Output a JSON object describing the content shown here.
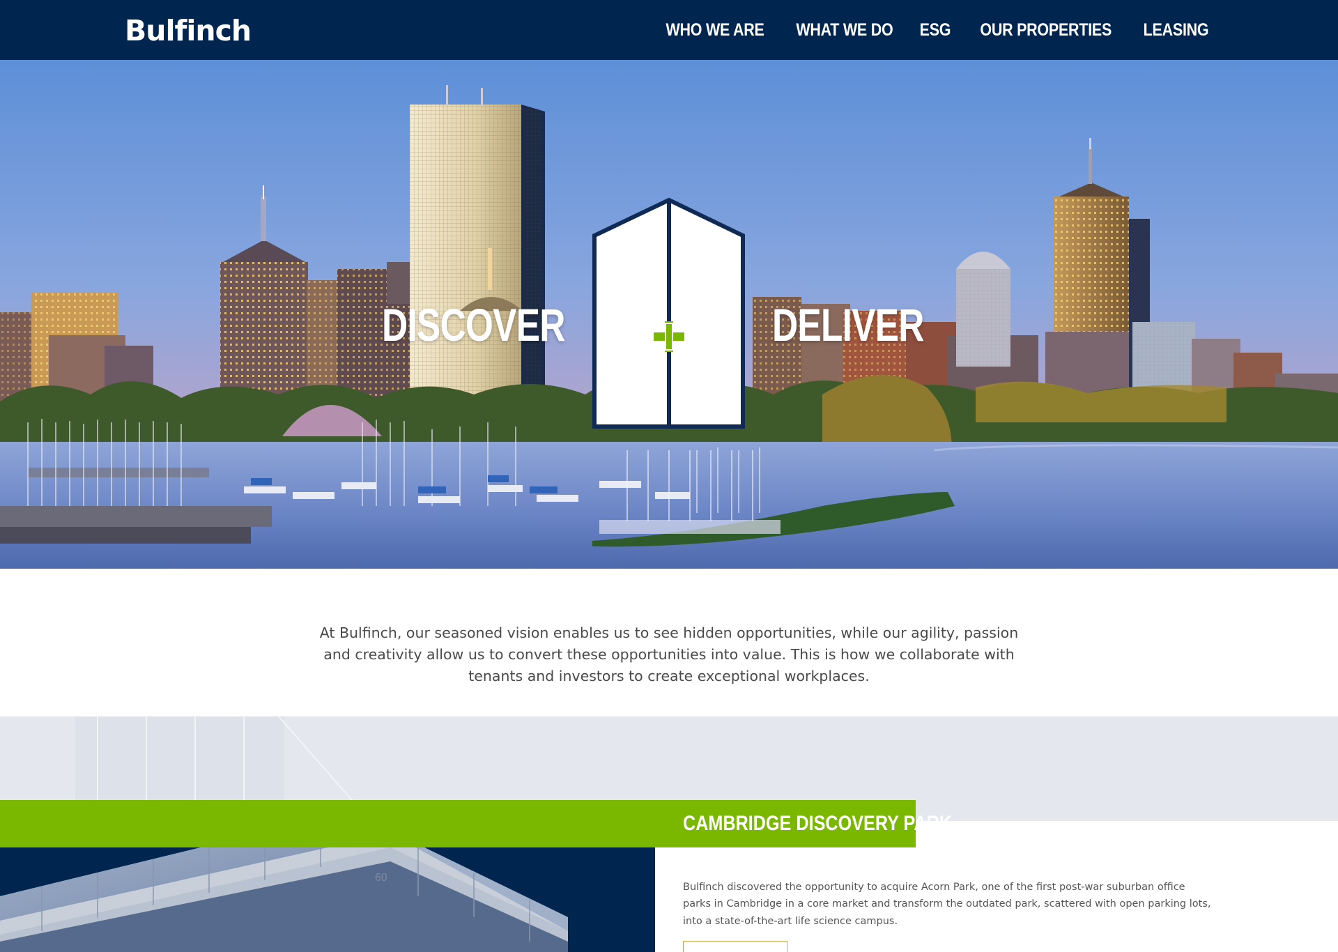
{
  "header": {
    "logo": "Bulfinch",
    "nav": [
      "WHO WE ARE",
      "WHAT WE DO",
      "ESG",
      "OUR PROPERTIES",
      "LEASING"
    ]
  },
  "hero": {
    "left_word": "DISCOVER",
    "right_word": "DELIVER",
    "plus": "+"
  },
  "intro": {
    "text": "At Bulfinch, our seasoned vision enables us to see hidden opportunities, while our agility, passion and creativity allow us to convert these opportunities into value. This is how we collaborate with tenants and investors to create exceptional workplaces."
  },
  "feature": {
    "title": "CAMBRIDGE DISCOVERY PARK",
    "text": "Bulfinch discovered the opportunity to acquire Acorn Park, one of the first post-war suburban office parks in Cambridge in a core market and transform the outdated park, scattered with open parking lots, into a state-of-the-art life science campus.",
    "building_number": "60"
  },
  "colors": {
    "navy": "#002650",
    "green": "#7ab800",
    "gold": "#c9a24a"
  }
}
